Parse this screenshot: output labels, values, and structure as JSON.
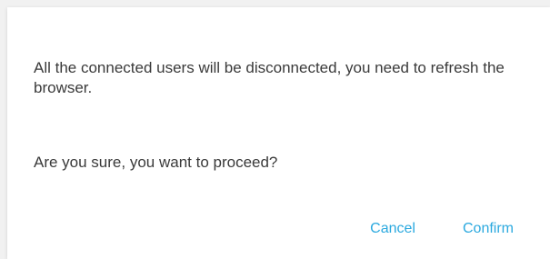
{
  "dialog": {
    "message": "All the connected users will be disconnected, you need to refresh the browser.",
    "question": "Are you sure, you want to proceed?",
    "cancel_label": "Cancel",
    "confirm_label": "Confirm"
  },
  "colors": {
    "accent": "#2ba9df",
    "text": "#3a3a3a",
    "background": "#ffffff"
  }
}
